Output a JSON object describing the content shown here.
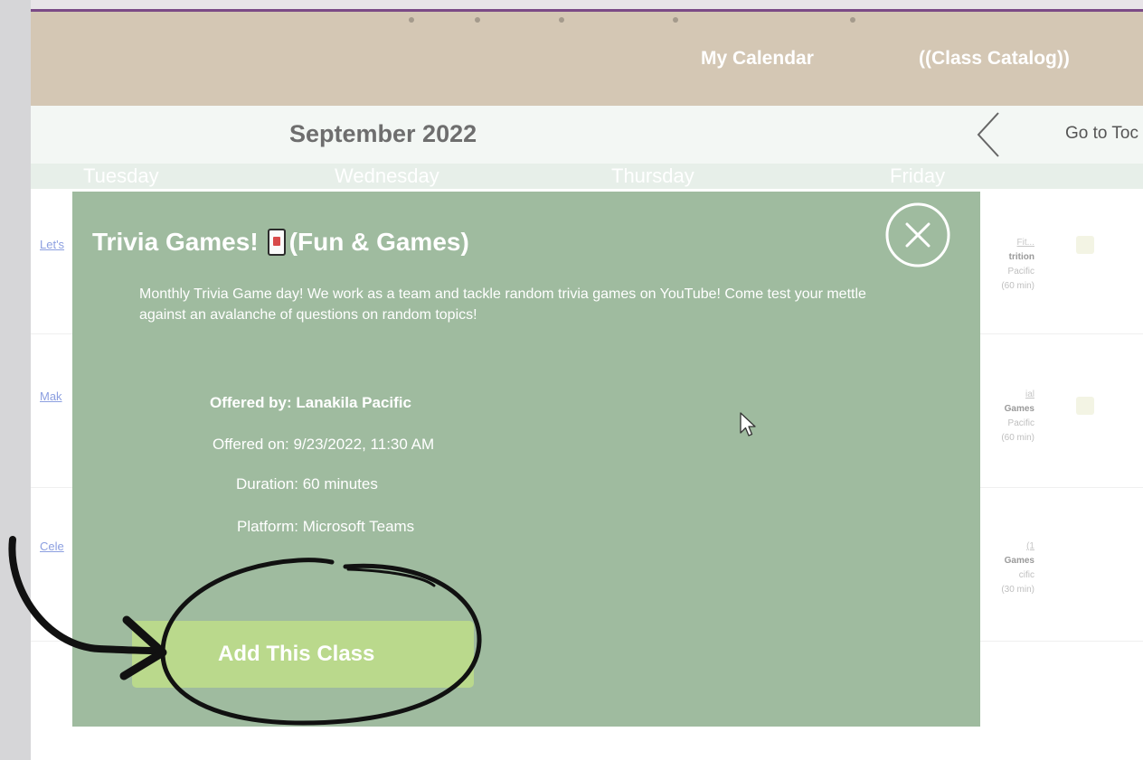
{
  "nav": {
    "my_calendar": "My Calendar",
    "class_catalog": "((Class Catalog))"
  },
  "calendar": {
    "month": "September 2022",
    "go_today": "Go to Toc",
    "prev_icon": "chevron-left-icon",
    "days": [
      "Tuesday",
      "Wednesday",
      "Thursday",
      "Friday"
    ]
  },
  "background_rows": {
    "left_links": [
      "Let's",
      "Mak",
      "Cele"
    ],
    "cards": [
      {
        "title": "Fit...",
        "line1": "trition",
        "line2": "Pacific",
        "line3": "(60 min)"
      },
      {
        "title": "ial",
        "line1": "Games",
        "line2": "Pacific",
        "line3": "(60 min)"
      },
      {
        "title": "(1",
        "line1": "Games",
        "line2": "cific",
        "line3": "(30 min)"
      }
    ]
  },
  "modal": {
    "title": "Trivia Games!",
    "title_suffix": "(Fun & Games)",
    "title_icon": "playing-card-icon",
    "close_icon": "close-circle-icon",
    "description": "Monthly Trivia Game day! We work as a team and tackle random trivia games on YouTube! Come test your mettle against an avalanche of questions on random topics!",
    "offered_by": "Offered by: Lanakila Pacific",
    "offered_on": "Offered on: 9/23/2022, 11:30 AM",
    "duration": "Duration: 60 minutes",
    "platform": "Platform: Microsoft Teams",
    "add_button": "Add This Class"
  },
  "colors": {
    "nav_bg": "#d4c7b4",
    "accent_line": "#7b4a86",
    "modal_bg": "#9fbb9f",
    "add_button_bg": "#bad98c",
    "annotation_ink": "#111111"
  },
  "annotation": {
    "shapes": [
      "hand-drawn-circle",
      "hand-drawn-arrow"
    ]
  }
}
